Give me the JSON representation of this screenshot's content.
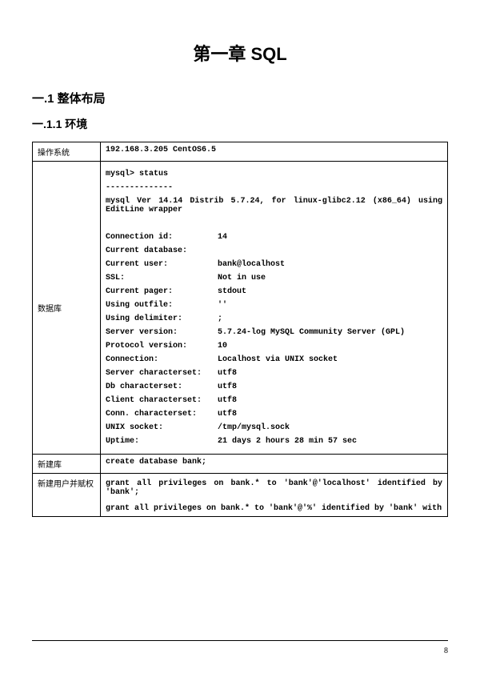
{
  "chapter_title": "第一章 SQL",
  "section1": "一.1  整体布局",
  "section1_1": "一.1.1  环境",
  "rows": {
    "os": {
      "label": "操作系统",
      "value": "192.168.3.205 CentOS6.5"
    },
    "db": {
      "label": "数据库"
    },
    "createdb": {
      "label": "新建库",
      "value": "create database bank;"
    },
    "grant": {
      "label": "新建用户并赋权"
    }
  },
  "db_block": {
    "line1": "mysql> status",
    "line2": "--------------",
    "line3": "mysql  Ver 14.14 Distrib 5.7.24, for linux-glibc2.12 (x86_64) using EditLine wrapper",
    "pairs": [
      {
        "k": "Connection id:",
        "v": "14"
      },
      {
        "k": "Current database:",
        "v": ""
      },
      {
        "k": "Current user:",
        "v": "bank@localhost"
      },
      {
        "k": "SSL:",
        "v": "Not in use"
      },
      {
        "k": "Current pager:",
        "v": "stdout"
      },
      {
        "k": "Using outfile:",
        "v": "''"
      },
      {
        "k": "Using delimiter:",
        "v": ";"
      },
      {
        "k": "Server version:",
        "v": "5.7.24-log MySQL Community Server (GPL)"
      },
      {
        "k": "Protocol version:",
        "v": "10"
      },
      {
        "k": "Connection:",
        "v": "Localhost via UNIX socket"
      },
      {
        "k": "Server characterset:",
        "v": "utf8"
      },
      {
        "k": "Db     characterset:",
        "v": "utf8"
      },
      {
        "k": "Client characterset:",
        "v": "utf8"
      },
      {
        "k": "Conn.  characterset:",
        "v": "utf8"
      },
      {
        "k": "UNIX socket:",
        "v": "/tmp/mysql.sock"
      },
      {
        "k": "Uptime:",
        "v": "21 days 2 hours 28 min 57 sec"
      }
    ]
  },
  "grant_block": {
    "l1": "grant all privileges on bank.* to 'bank'@'localhost' identified by 'bank';",
    "l2": "grant all privileges on bank.* to 'bank'@'%' identified by 'bank' with"
  },
  "page_number": "8"
}
